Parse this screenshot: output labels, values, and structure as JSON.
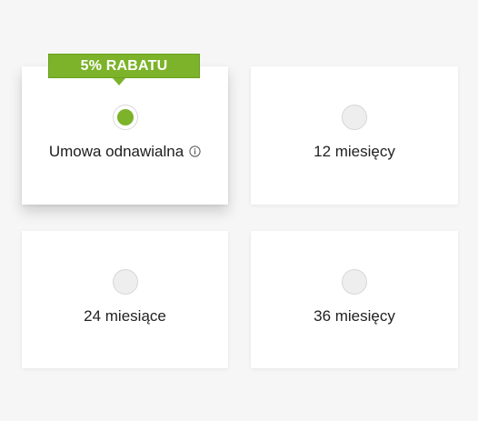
{
  "options": [
    {
      "label": "Umowa odnawialna",
      "selected": true,
      "has_info": true,
      "info_icon": "info-circle-icon"
    },
    {
      "label": "12 miesięcy",
      "selected": false
    },
    {
      "label": "24 miesiące",
      "selected": false
    },
    {
      "label": "36 miesięcy",
      "selected": false
    }
  ],
  "badge": {
    "text": "5% RABATU"
  },
  "colors": {
    "accent": "#7cb32a",
    "background": "#f6f6f6",
    "card": "#ffffff",
    "radio_unchecked": "#eeeeee"
  }
}
